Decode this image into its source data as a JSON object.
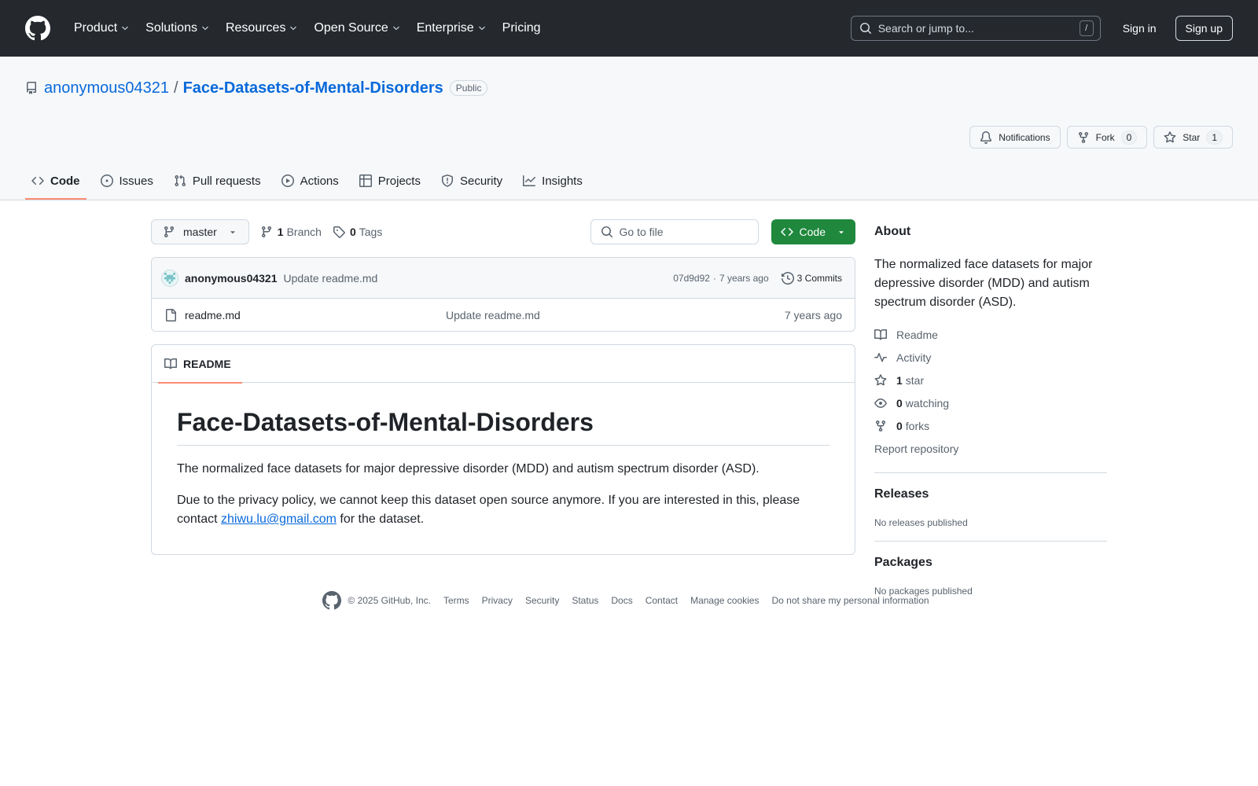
{
  "header": {
    "nav": [
      {
        "label": "Product",
        "has_menu": true
      },
      {
        "label": "Solutions",
        "has_menu": true
      },
      {
        "label": "Resources",
        "has_menu": true
      },
      {
        "label": "Open Source",
        "has_menu": true
      },
      {
        "label": "Enterprise",
        "has_menu": true
      },
      {
        "label": "Pricing",
        "has_menu": false
      }
    ],
    "search_placeholder": "Search or jump to...",
    "search_key": "/",
    "sign_in": "Sign in",
    "sign_up": "Sign up"
  },
  "repo": {
    "owner": "anonymous04321",
    "separator": "/",
    "name": "Face-Datasets-of-Mental-Disorders",
    "visibility": "Public",
    "actions": {
      "notifications": "Notifications",
      "fork": "Fork",
      "fork_count": "0",
      "star": "Star",
      "star_count": "1"
    },
    "tabs": [
      {
        "label": "Code",
        "icon": "code-icon",
        "active": true
      },
      {
        "label": "Issues",
        "icon": "issue-icon",
        "active": false
      },
      {
        "label": "Pull requests",
        "icon": "pull-request-icon",
        "active": false
      },
      {
        "label": "Actions",
        "icon": "play-icon",
        "active": false
      },
      {
        "label": "Projects",
        "icon": "table-icon",
        "active": false
      },
      {
        "label": "Security",
        "icon": "shield-icon",
        "active": false
      },
      {
        "label": "Insights",
        "icon": "graph-icon",
        "active": false
      }
    ]
  },
  "toolbar": {
    "branch": "master",
    "branch_count": "1",
    "branch_label": "Branch",
    "tag_count": "0",
    "tag_label": "Tags",
    "goto_placeholder": "Go to file",
    "code_button": "Code"
  },
  "latest_commit": {
    "author": "anonymous04321",
    "message": "Update readme.md",
    "sha": "07d9d92",
    "meta_sep": "·",
    "age": "7 years ago",
    "commits": "3 Commits"
  },
  "files": [
    {
      "name": "readme.md",
      "commit": "Update readme.md",
      "age": "7 years ago"
    }
  ],
  "readme": {
    "tab": "README",
    "title": "Face-Datasets-of-Mental-Disorders",
    "p1": "The normalized face datasets for major depressive disorder (MDD) and autism spectrum disorder (ASD).",
    "p2_before": "Due to the privacy policy, we cannot keep this dataset open source anymore. If you are interested in this, please contact ",
    "p2_link": "zhiwu.lu@gmail.com",
    "p2_after": " for the dataset."
  },
  "about": {
    "heading": "About",
    "description": "The normalized face datasets for major depressive disorder (MDD) and autism spectrum disorder (ASD).",
    "readme": "Readme",
    "activity": "Activity",
    "stars_count": "1",
    "stars_label": "star",
    "watching_count": "0",
    "watching_label": "watching",
    "forks_count": "0",
    "forks_label": "forks",
    "report": "Report repository"
  },
  "releases": {
    "heading": "Releases",
    "note": "No releases published"
  },
  "packages": {
    "heading": "Packages",
    "note": "No packages published"
  },
  "footer": {
    "copyright": "© 2025 GitHub, Inc.",
    "links": [
      "Terms",
      "Privacy",
      "Security",
      "Status",
      "Docs",
      "Contact",
      "Manage cookies",
      "Do not share my personal information"
    ]
  },
  "colors": {
    "header_bg": "#25292e",
    "link": "#0969da",
    "primary_button": "#1f883d",
    "active_tab_underline": "#fd8c73"
  }
}
